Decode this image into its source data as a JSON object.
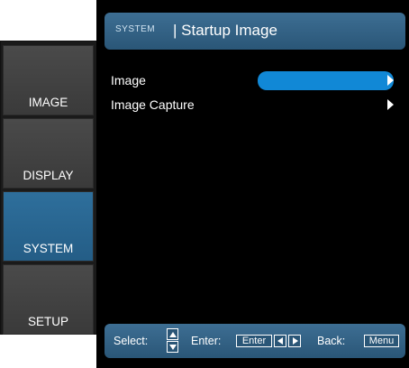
{
  "tabs": [
    {
      "label": "IMAGE",
      "active": false
    },
    {
      "label": "DISPLAY",
      "active": false
    },
    {
      "label": "SYSTEM",
      "active": true
    },
    {
      "label": "SETUP",
      "active": false
    }
  ],
  "header": {
    "category": "SYSTEM",
    "title": "| Startup Image"
  },
  "menu": {
    "items": [
      {
        "label": "Image",
        "selected": true
      },
      {
        "label": "Image Capture",
        "selected": false
      }
    ]
  },
  "footer": {
    "select_label": "Select:",
    "enter_label": "Enter:",
    "enter_key": "Enter",
    "back_label": "Back:",
    "menu_key": "Menu"
  },
  "colors": {
    "accent": "#1188d6",
    "header_bg": "#2f6286",
    "active_tab": "#2a6892",
    "panel_bg": "#000000"
  },
  "icons": [
    "chevron-right-icon",
    "arrow-up-icon",
    "arrow-down-icon",
    "arrow-left-icon",
    "arrow-right-icon"
  ]
}
